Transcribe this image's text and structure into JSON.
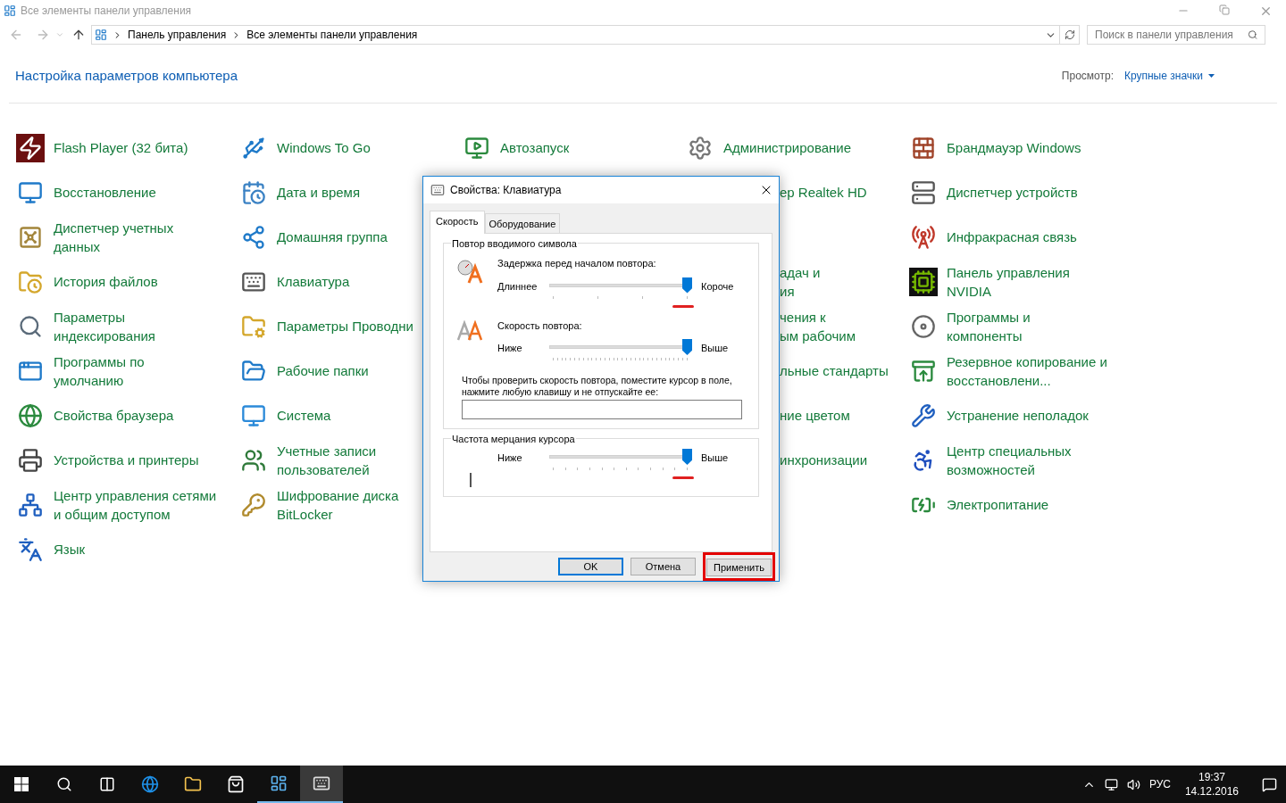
{
  "window": {
    "title": "Все элементы панели управления"
  },
  "address_bar": {
    "path": [
      "Панель управления",
      "Все элементы панели управления"
    ]
  },
  "search": {
    "placeholder": "Поиск в панели управления"
  },
  "heading": "Настройка параметров компьютера",
  "view": {
    "label": "Просмотр:",
    "value": "Крупные значки"
  },
  "columns": [
    {
      "items": [
        {
          "label": "Flash Player (32 бита)"
        },
        {
          "label": "Восстановление"
        },
        {
          "label": "Диспетчер учетных\nданных"
        },
        {
          "label": "История файлов"
        },
        {
          "label": "Параметры\nиндексирования"
        },
        {
          "label": "Программы по\nумолчанию"
        },
        {
          "label": "Свойства браузера"
        },
        {
          "label": "Устройства и принтеры"
        },
        {
          "label": "Центр управления сетями\nи общим доступом"
        },
        {
          "label": "Язык"
        }
      ]
    },
    {
      "items": [
        {
          "label": "Windows To Go"
        },
        {
          "label": "Дата и время"
        },
        {
          "label": "Домашняя группа"
        },
        {
          "label": "Клавиатура"
        },
        {
          "label": "Параметры Проводни"
        },
        {
          "label": "Рабочие папки"
        },
        {
          "label": "Система"
        },
        {
          "label": "Учетные записи\nпользователей"
        },
        {
          "label": "Шифрование диска\nBitLocker"
        }
      ]
    },
    {
      "items": [
        {
          "label": "Автозапуск"
        }
      ]
    },
    {
      "items": [
        {
          "label": "Администрирование"
        }
      ],
      "covered_items": [
        {
          "label": "ер Realtek HD"
        }
      ],
      "lower_covered_items": [
        {
          "label": "адач и\nия"
        },
        {
          "label": "чения к\nым рабочим"
        },
        {
          "label": "льные стандарты"
        },
        {
          "label": "ние цветом"
        },
        {
          "label": "инхронизации"
        }
      ]
    },
    {
      "items": [
        {
          "label": "Брандмауэр Windows"
        },
        {
          "label": "Диспетчер устройств"
        },
        {
          "label": "Инфракрасная связь"
        },
        {
          "label": "Панель управления\nNVIDIA"
        },
        {
          "label": "Программы и\nкомпоненты"
        },
        {
          "label": "Резервное копирование и\nвосстановлени..."
        },
        {
          "label": "Устранение неполадок"
        },
        {
          "label": "Центр специальных\nвозможностей"
        },
        {
          "label": "Электропитание"
        }
      ]
    }
  ],
  "dialog": {
    "title": "Свойства: Клавиатура",
    "tabs": [
      {
        "label": "Скорость",
        "selected": true
      },
      {
        "label": "Оборудование",
        "selected": false
      }
    ],
    "groups": [
      {
        "title": "Повтор вводимого символа",
        "sliders": [
          {
            "kind": "delay",
            "label": "Задержка перед началом повтора:",
            "min_label": "Длиннее",
            "max_label": "Короче",
            "level": 1,
            "marked": true
          },
          {
            "kind": "rate",
            "label": "Скорость повтора:",
            "min_label": "Ниже",
            "max_label": "Выше",
            "level": 1,
            "marked": false
          }
        ],
        "test": {
          "text": "Чтобы проверить скорость повтора, поместите курсор в поле, нажмите любую клавишу и не отпускайте ее:"
        }
      },
      {
        "title": "Частота мерцания курсора",
        "sliders": [
          {
            "kind": "blink",
            "min_label": "Ниже",
            "max_label": "Выше",
            "level": 1,
            "marked": true
          }
        ]
      }
    ],
    "buttons": [
      {
        "label": "OK",
        "default": true,
        "highlighted": false
      },
      {
        "label": "Отмена",
        "default": false,
        "highlighted": false
      },
      {
        "label": "Применить",
        "default": false,
        "highlighted": true
      }
    ]
  },
  "taskbar": {
    "apps": [
      {
        "kind": "edge",
        "running": false,
        "focused": false
      },
      {
        "kind": "explorer",
        "running": false,
        "focused": false
      },
      {
        "kind": "store",
        "running": false,
        "focused": false
      },
      {
        "kind": "control_panel",
        "running": true,
        "focused": false
      },
      {
        "kind": "keyboard",
        "running": true,
        "focused": true
      }
    ],
    "language": "РУС",
    "time": "19:37",
    "date": "14.12.2016"
  }
}
